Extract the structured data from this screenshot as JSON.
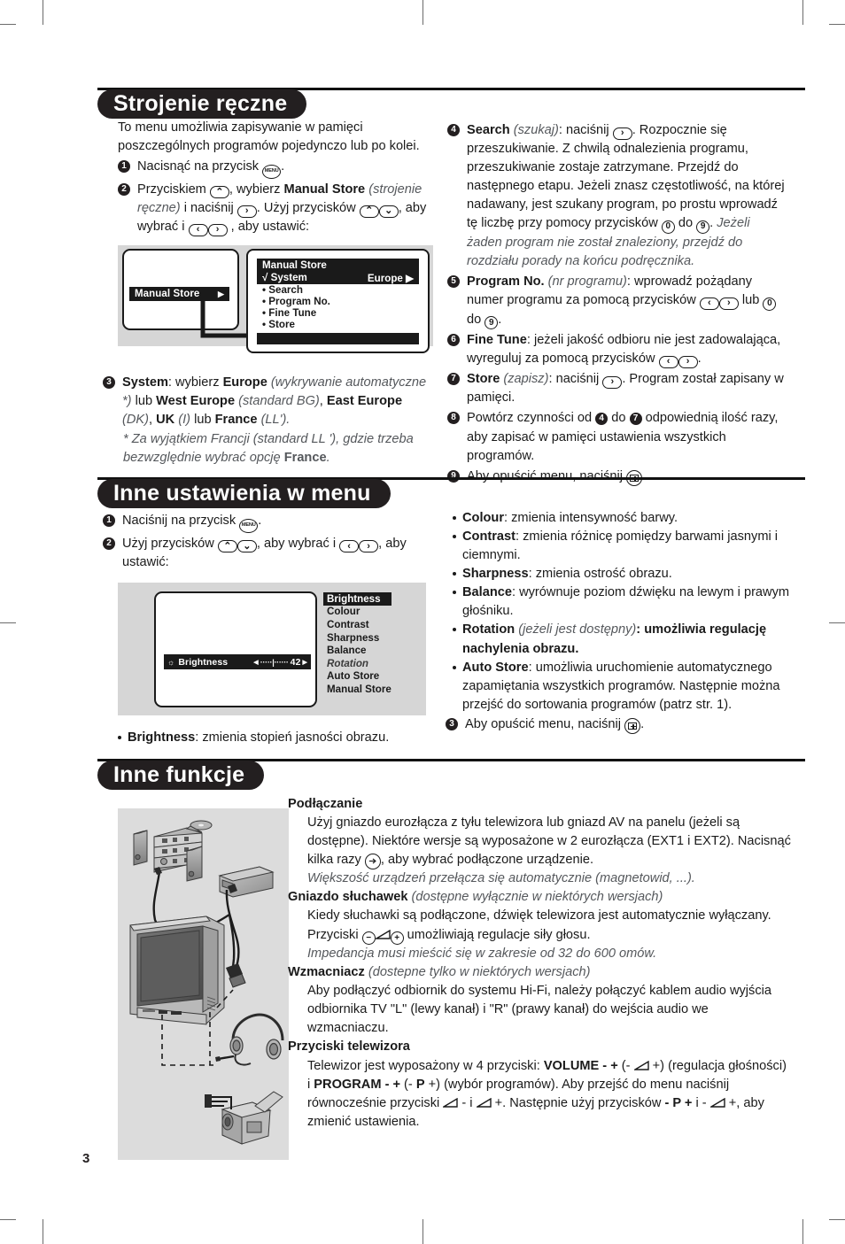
{
  "page": {
    "number": "3"
  },
  "sections": {
    "manual_store": {
      "title": "Strojenie ręczne",
      "intro": "To menu umożliwia zapisywanie w pamięci poszczególnych programów pojedynczo lub po kolei.",
      "step1": {
        "pre": "Nacisnąć na przycisk ",
        "key": "MENU",
        "post": "."
      },
      "step2": {
        "t1": "Przyciskiem ",
        "k1": "∧",
        "t2": ", wybierz ",
        "bold1": "Manual Store",
        "it1": "(strojenie ręczne)",
        "t3": " i naciśnij ",
        "k2": "〉",
        "t4": ". Użyj przycisków ",
        "k3": "∧",
        "k4": "∨",
        "t5": ", aby wybrać i ",
        "k5": "〈",
        "k6": "〉",
        "t6": " , aby ustawić:"
      },
      "step3": {
        "b1": "System",
        "t1": ": wybierz ",
        "b2": "Europe",
        "i1": "(wykrywanie automatyczne *)",
        "t2": " lub ",
        "b3": "West Europe",
        "i2": "(standard BG)",
        "t3": ", ",
        "b4": "East Europe",
        "i3": "(DK)",
        "t4": ", ",
        "b5": "UK",
        "i4": "(I)",
        "t5": " lub ",
        "b6": "France",
        "i5": "(LL').",
        "note": "* Za wyjątkiem Francji (standard LL '), gdzie trzeba bezwzględnie wybrać opcję ",
        "note_bold": "France",
        "note_end": "."
      },
      "step4": {
        "b1": "Search",
        "i1": "(szukaj)",
        "t1": ": naciśnij ",
        "k1": "〉",
        "t2": ". Rozpocznie się przeszukiwanie. Z chwilą odnalezienia programu, przeszukiwanie zostaje zatrzymane. Przejdź do następnego etapu. Jeżeli znasz częstotliwość, na której nadawany, jest szukany program, po prostu wprowadź tę liczbę przy pomocy przycisków ",
        "k2": "0",
        "t3": " do ",
        "k3": "9",
        "t4": ". ",
        "i2": "Jeżeli żaden program nie został znaleziony, przejdź do rozdziału porady na końcu podręcznika."
      },
      "step5": {
        "b1": "Program No.",
        "i1": "(nr programu)",
        "t1": ": wprowadź pożądany numer programu za pomocą przycisków ",
        "k1": "〈",
        "k2": "〉",
        "t2": " lub ",
        "k3": "0",
        "t3": " do ",
        "k4": "9",
        "t4": "."
      },
      "step6": {
        "b1": "Fine Tune",
        "t1": ": jeżeli jakość odbioru nie jest zadowalająca, wyreguluj za pomocą przycisków ",
        "k1": "〈",
        "k2": "〉",
        "t2": "."
      },
      "step7": {
        "b1": "Store",
        "i1": "(zapisz)",
        "t1": ": naciśnij ",
        "k1": "〉",
        "t2": ". Program został zapisany w pamięci."
      },
      "step8": {
        "t1": "Powtórz czynności od ",
        "n1": "4",
        "t2": " do ",
        "n2": "7",
        "t3": " odpowiednią ilość razy, aby zapisać w pamięci ustawienia wszystkich programów."
      },
      "step9": {
        "t1": "Aby opuścić menu, naciśnij ",
        "k1": "menu-exit",
        "t2": "."
      },
      "osd_left": {
        "label": "Manual Store",
        "arrow": "▶"
      },
      "osd_right": {
        "header": "Manual Store",
        "rows": [
          {
            "mark": "√",
            "label": "System",
            "value": "Europe ▶",
            "selected": true
          },
          {
            "mark": "•",
            "label": "Search",
            "value": ""
          },
          {
            "mark": "•",
            "label": "Program No.",
            "value": ""
          },
          {
            "mark": "•",
            "label": "Fine Tune",
            "value": ""
          },
          {
            "mark": "•",
            "label": "Store",
            "value": ""
          }
        ]
      }
    },
    "other_menu": {
      "title": "Inne ustawienia w menu",
      "step1": {
        "pre": "Naciśnij na przycisk ",
        "key": "MENU",
        "post": "."
      },
      "step2": {
        "t1": "Użyj przycisków ",
        "k1": "∧",
        "k2": "∨",
        "t2": ", aby wybrać i ",
        "k3": "〈",
        "k4": "〉",
        "t3": ", aby ustawić:"
      },
      "osd": {
        "slider": {
          "icon": "☼",
          "label": "Brightness",
          "left": "◀",
          "track": "·····|······",
          "value": "42",
          "right": "▶"
        },
        "items": [
          {
            "label": "Brightness",
            "selected": true,
            "italic": false
          },
          {
            "label": "Colour",
            "selected": false,
            "italic": false
          },
          {
            "label": "Contrast",
            "selected": false,
            "italic": false
          },
          {
            "label": "Sharpness",
            "selected": false,
            "italic": false
          },
          {
            "label": "Balance",
            "selected": false,
            "italic": false
          },
          {
            "label": "Rotation",
            "selected": false,
            "italic": true
          },
          {
            "label": "Auto Store",
            "selected": false,
            "italic": false
          },
          {
            "label": "Manual Store",
            "selected": false,
            "italic": false
          }
        ]
      },
      "bullets": [
        {
          "bold": "Brightness",
          "text": ": zmienia stopień jasności obrazu.",
          "italic": ""
        },
        {
          "bold": "Colour",
          "text": ": zmienia intensywność barwy.",
          "italic": ""
        },
        {
          "bold": "Contrast",
          "text": ": zmienia różnicę pomiędzy barwami jasnymi i ciemnymi.",
          "italic": ""
        },
        {
          "bold": "Sharpness",
          "text": ": zmienia ostrość obrazu.",
          "italic": ""
        },
        {
          "bold": "Balance",
          "text": ": wyrównuje poziom dźwięku na lewym i prawym głośniku.",
          "italic": ""
        },
        {
          "bold": "Rotation",
          "italic": "(jeżeli jest dostępny)",
          "text": ": umożliwia regulację nachylenia obrazu."
        },
        {
          "bold": "Auto Store",
          "italic": "",
          "text": ": umożliwia uruchomienie automatycznego zapamiętania wszystkich programów. Następnie można przejść do sortowania programów (patrz str. 1)."
        }
      ],
      "step3": {
        "t1": "Aby opuścić menu, naciśnij ",
        "k1": "menu-exit",
        "t2": "."
      }
    },
    "other_functions": {
      "title": "Inne funkcje",
      "blocks": [
        {
          "heading": "Podłączanie",
          "heading_italic": "",
          "lines": [
            {
              "text": "Użyj gniazdo eurozłącza z tyłu telewizora lub gniazd AV na panelu (jeżeli są dostępne). Niektóre wersje są wyposażone w 2 eurozłącza (EXT1 i EXT2). Nacisnąć kilka razy ",
              "key": "av",
              "after": ", aby wybrać podłączone urządzenie."
            },
            {
              "italic": "Większość urządzeń przełącza się automatycznie (magnetowid, ...)."
            }
          ]
        },
        {
          "heading": "Gniazdo słuchawek",
          "heading_italic": "(dostępne wyłącznie w niektórych wersjach)",
          "lines": [
            {
              "text": "Kiedy słuchawki są podłączone, dźwięk telewizora jest automatycznie wyłączany. Przyciski ",
              "key": "minus-vol-plus",
              "after": " umożliwiają regulacje siły głosu."
            },
            {
              "italic": "Impedancja musi mieścić się w zakresie od 32 do 600 omów."
            }
          ]
        },
        {
          "heading": "Wzmacniacz",
          "heading_italic": "(dostepne tylko w niektórych wersjach)",
          "lines": [
            {
              "text": "Aby podłączyć odbiornik do systemu Hi-Fi, należy połączyć kablem audio wyjścia odbiornika TV \"L\" (lewy kanał) i \"R\" (prawy kanał) do wejścia audio we wzmacniaczu."
            }
          ]
        },
        {
          "heading": "Przyciski telewizora",
          "heading_italic": "",
          "lines": [
            {
              "rich": "tv-buttons"
            }
          ]
        }
      ],
      "tv_buttons_text": {
        "t1": "Telewizor jest wyposażony w 4 przyciski: ",
        "b1": "VOLUME - +",
        "t2": " (- ",
        "t3": " +) (regulacja głośności) i ",
        "b2": "PROGRAM - +",
        "t4": " (- ",
        "b3": "P",
        "t5": " +) (wybór programów). Aby przejść do menu naciśnij równocześnie przyciski ",
        "t6": " - i ",
        "t7": " +. Następnie użyj przycisków ",
        "b4": "- P +",
        "t8": " i - ",
        "t9": " +, aby zmienić ustawienia."
      }
    }
  },
  "colors": {
    "ink": "#231f20",
    "osd_bg": "#d6d6d6",
    "illustration_bg": "#dcdcdc"
  }
}
